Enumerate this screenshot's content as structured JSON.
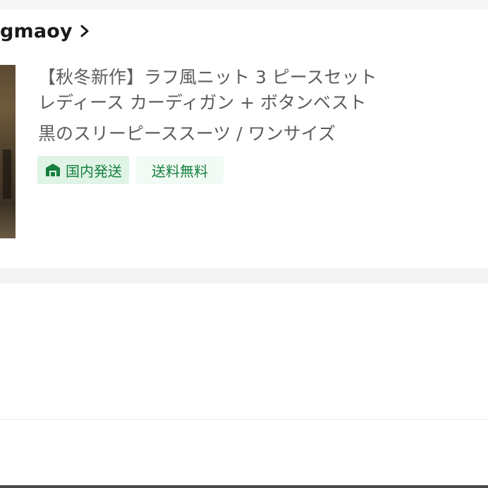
{
  "store": {
    "name": "gmaoy"
  },
  "product": {
    "title_lines": [
      "【秋冬新作】ラフ風ニット 3 ピースセット",
      "レディース カーディガン + ボタンベスト",
      "黒のスリーピーススーツ / ワンサイズ"
    ],
    "tags": [
      {
        "label": "国内発送",
        "icon": "warehouse-icon"
      },
      {
        "label": "送料無料"
      }
    ]
  },
  "colors": {
    "tag_green": "#15803d",
    "tag_bg": "#dff3e6"
  }
}
